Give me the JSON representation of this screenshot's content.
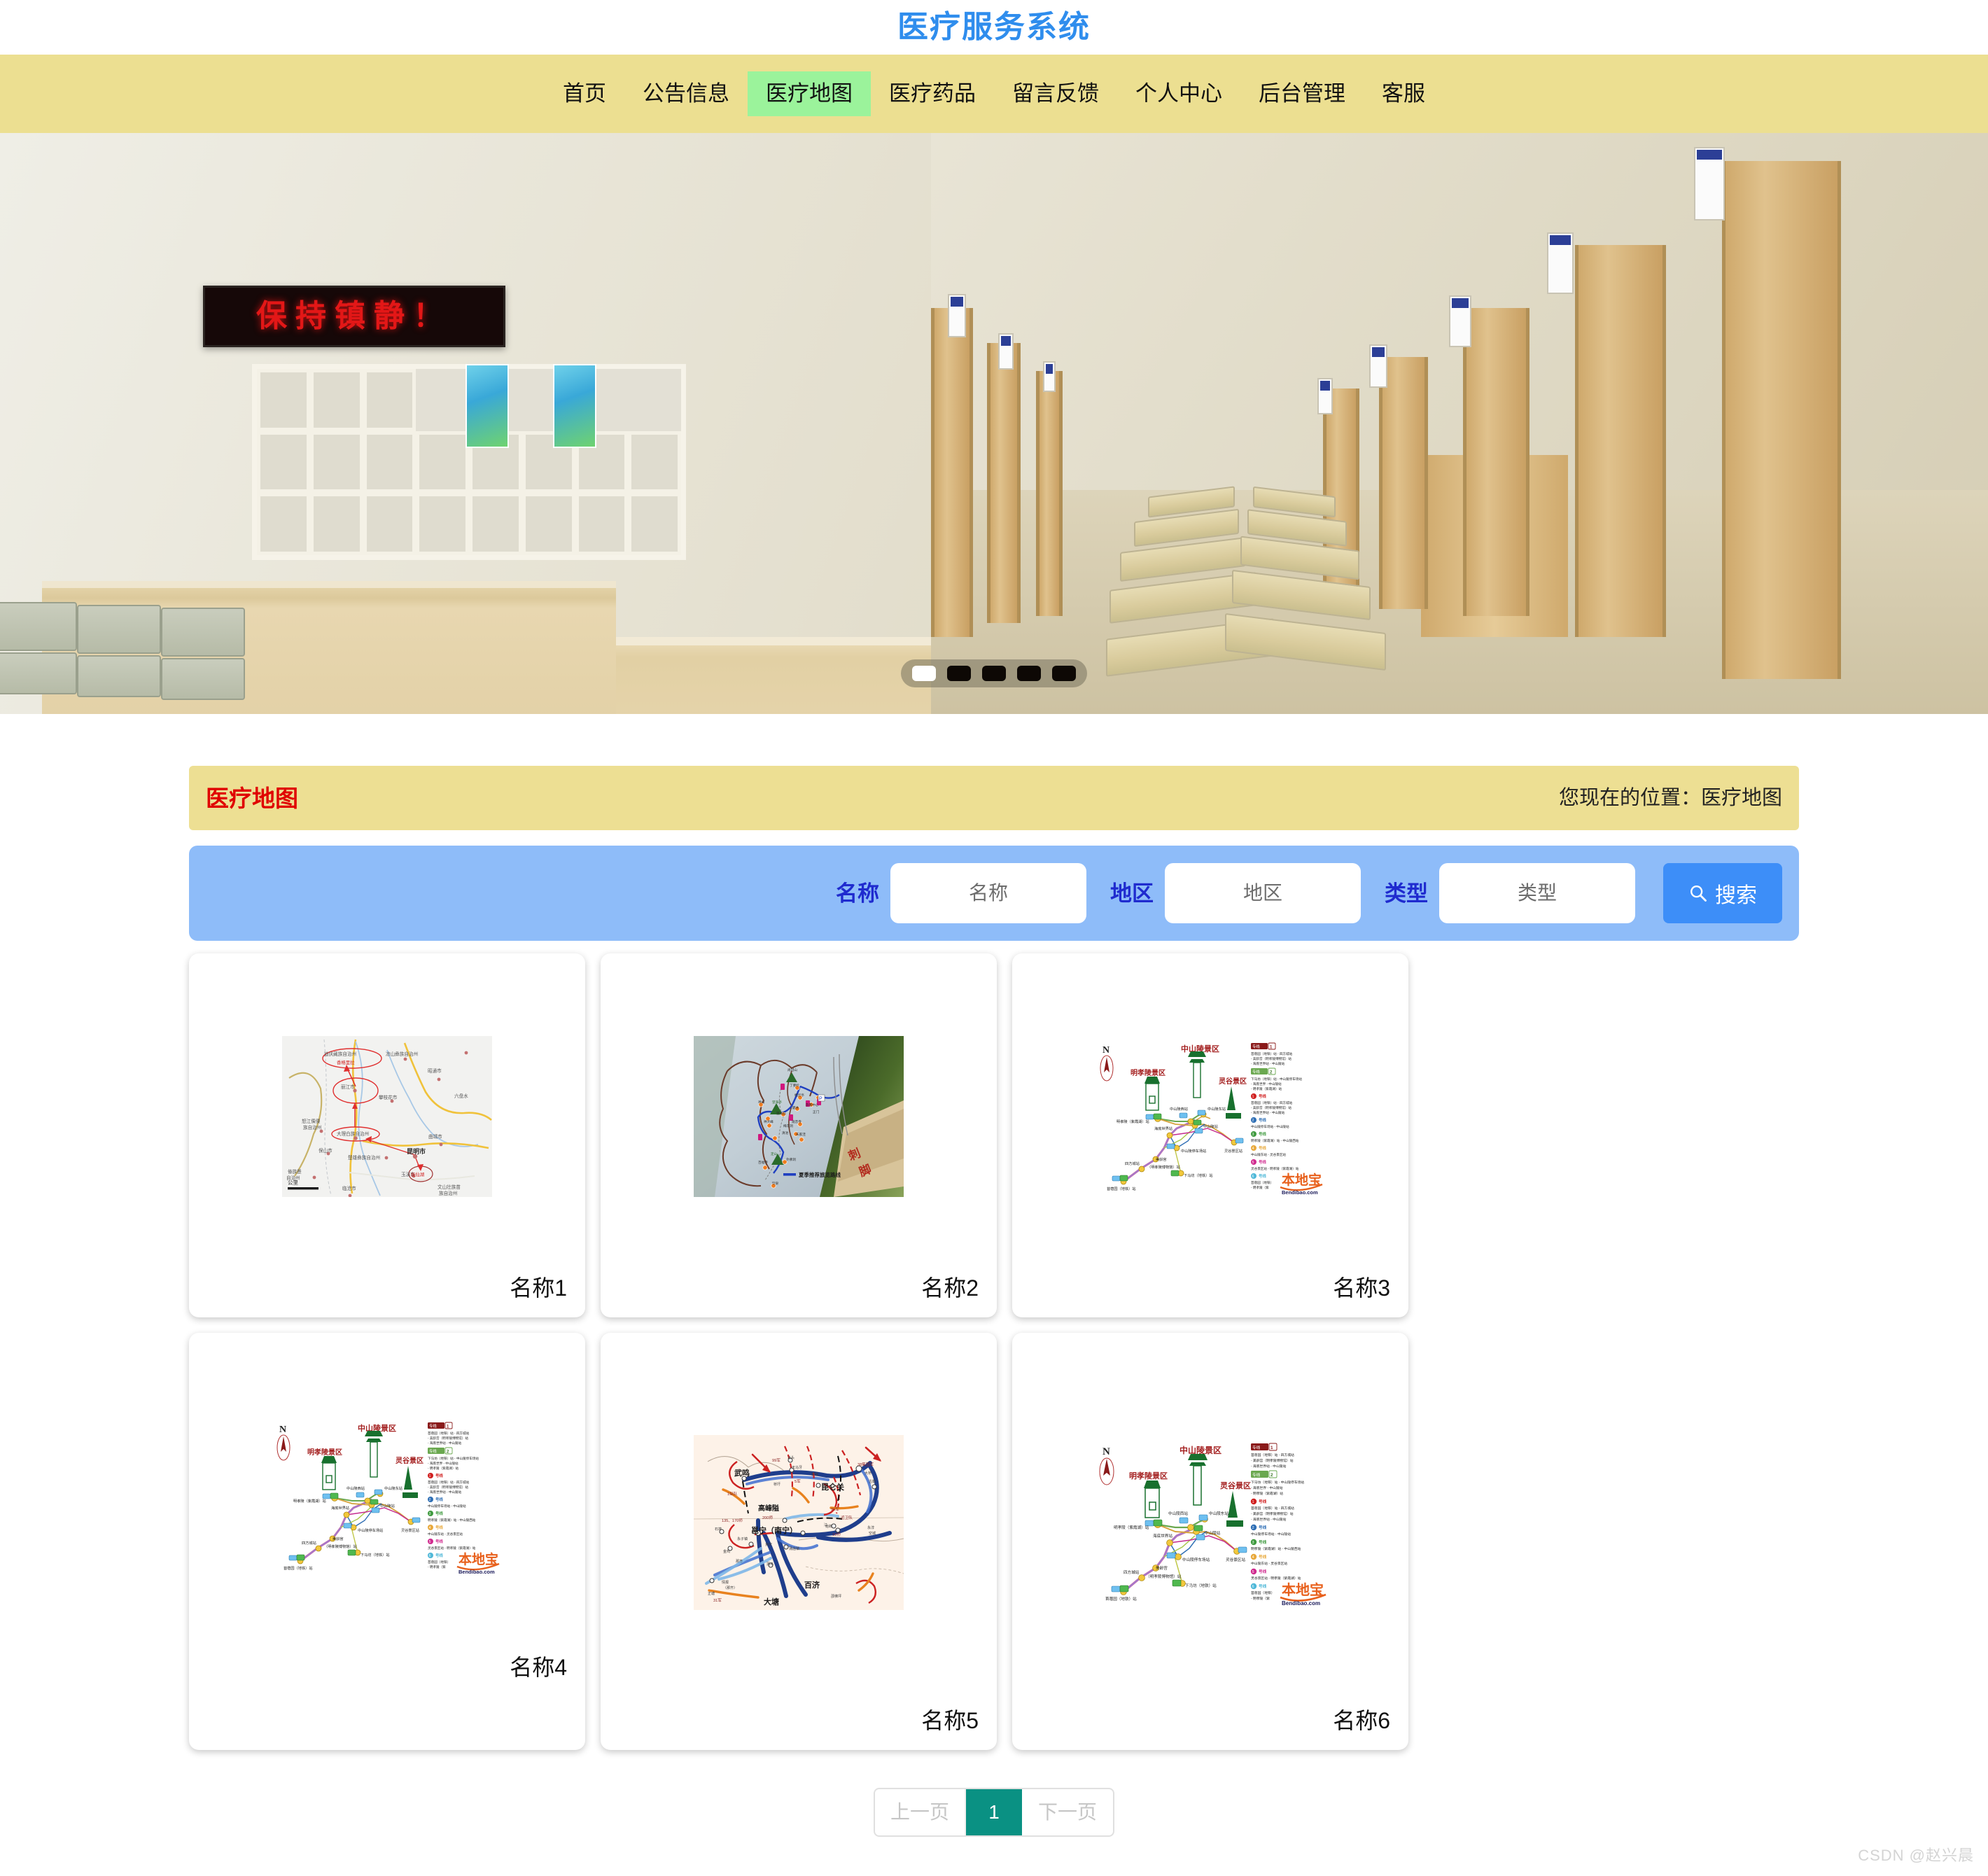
{
  "site": {
    "title": "医疗服务系统"
  },
  "nav": {
    "items": [
      {
        "label": "首页",
        "active": false
      },
      {
        "label": "公告信息",
        "active": false
      },
      {
        "label": "医疗地图",
        "active": true
      },
      {
        "label": "医疗药品",
        "active": false
      },
      {
        "label": "留言反馈",
        "active": false
      },
      {
        "label": "个人中心",
        "active": false
      },
      {
        "label": "后台管理",
        "active": false
      },
      {
        "label": "客服",
        "active": false
      }
    ]
  },
  "banner": {
    "led_sign_text": "保持镇静！",
    "dots": [
      {
        "active": true
      },
      {
        "active": false
      },
      {
        "active": false
      },
      {
        "active": false
      },
      {
        "active": false
      }
    ]
  },
  "section": {
    "title": "医疗地图",
    "breadcrumb": "您现在的位置：医疗地图"
  },
  "search": {
    "name_label": "名称",
    "name_placeholder": "名称",
    "name_value": "",
    "region_label": "地区",
    "region_placeholder": "地区",
    "region_value": "",
    "type_label": "类型",
    "type_placeholder": "类型",
    "type_value": "",
    "button_label": "搜索",
    "button_icon": "search-icon"
  },
  "cards": [
    {
      "label": "名称1",
      "image_kind": "yunnan-route-map",
      "image_caption_items": [
        "迪庆藏族自治州",
        "香格里拉",
        "丽江市",
        "大理白族自治州",
        "昆明市",
        "抚仙湖",
        "凉山彝族自治州",
        "昭通市",
        "攀枝花市",
        "六盘水",
        "曲靖市",
        "保山市",
        "楚雄彝族自治州",
        "怒江傈僳族自治州",
        "玉溪市",
        "临沧市",
        "文山壮族苗族自治州",
        "公里"
      ]
    },
    {
      "label": "名称2",
      "image_kind": "scenic-photo-map",
      "image_caption_items": [
        "夏季推荐旅览路线",
        "尚冠山",
        "丁婆岭",
        "栖灵亭",
        "神山",
        "望海亭",
        "望海石",
        "神犬峰",
        "观音寺",
        "朱家洼",
        "定山",
        "外佛洞",
        "百福寺",
        "饮泉"
      ]
    },
    {
      "label": "名称3",
      "image_kind": "zhongshan-transit-map",
      "image_caption_items": [
        "N",
        "中山陵景区",
        "明孝陵景区",
        "灵谷景区",
        "中山陵西站",
        "中山陵东站",
        "中山陵站",
        "明孝陵（紫霞湖）站",
        "海底世界站",
        "中山陵停车场站",
        "灵谷景区站",
        "四方城站",
        "美龄宫（明孝陵博物馆）站",
        "苜蓿园（地铁）站",
        "下马坊（地铁）站",
        "专线1",
        "专线2",
        "1号线",
        "2号线",
        "3号线",
        "4号线",
        "5号线",
        "6号线",
        "Bendibao.com"
      ]
    },
    {
      "label": "名称4",
      "image_kind": "zhongshan-transit-map",
      "image_caption_items": [
        "N",
        "中山陵景区",
        "明孝陵景区",
        "灵谷景区",
        "中山陵西站",
        "中山陵东站",
        "中山陵站",
        "明孝陵（紫霞湖）站",
        "海底世界站",
        "中山陵停车场站",
        "灵谷景区站",
        "四方城站",
        "美龄宫（明孝陵博物馆）站",
        "苜蓿园（地铁）站",
        "下马坊（地铁）站",
        "专线1",
        "专线2",
        "1号线",
        "2号线",
        "3号线",
        "4号线",
        "5号线",
        "6号线",
        "Bendibao.com"
      ]
    },
    {
      "label": "名称5",
      "image_kind": "battle-map",
      "image_caption_items": [
        "武鸣",
        "昆仑关",
        "高峰隘",
        "邕宁（南宁）",
        "百济",
        "大塘",
        "99军",
        "5军",
        "200师",
        "135、170师",
        "18师",
        "38集团军",
        "近卫队",
        "天马牙",
        "马头",
        "良庆",
        "石埠",
        "那齐",
        "金鸡"
      ]
    },
    {
      "label": "名称6",
      "image_kind": "zhongshan-transit-map",
      "image_caption_items": [
        "N",
        "中山陵景区",
        "明孝陵景区",
        "灵谷景区",
        "中山陵西站",
        "中山陵东站",
        "中山陵站",
        "明孝陵（紫霞湖）站",
        "海底世界站",
        "中山陵停车场站",
        "灵谷景区站",
        "四方城站",
        "美龄宫（明孝陵博物馆）站",
        "苜蓿园（地铁）站",
        "下马坊（地铁）站",
        "专线1",
        "专线2",
        "1号线",
        "2号线",
        "3号线",
        "4号线",
        "5号线",
        "6号线",
        "Bendibao.com"
      ]
    }
  ],
  "pagination": {
    "prev_label": "上一页",
    "current_page": "1",
    "next_label": "下一页"
  },
  "watermark": "CSDN @赵兴晨",
  "colors": {
    "nav_background": "#ecdf91",
    "nav_active": "#9bf39b",
    "title_blue": "#2f8ded",
    "section_head_bg": "#eddf93",
    "section_title_red": "#e00000",
    "search_bar_bg": "#8ebcf9",
    "search_button_blue": "#3d8ef8",
    "label_blue": "#1f2bcf",
    "pagination_active": "#0a9183",
    "led_red": "#e31717"
  }
}
